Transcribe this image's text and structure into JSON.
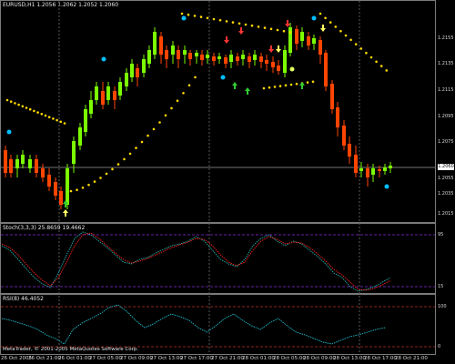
{
  "chart_window": {
    "price_title": "EURUSD,H1  1.2056 1.2062 1.2052 1.2060",
    "stoch_title": "Stoch(3,3,3) 25.8659 19.4662",
    "rsi_title": "RSI(8) 46.4052",
    "copyright": "MetaTrader, © 2001-2005 MetaQuotes Software Corp.",
    "current_price": "1.2060",
    "price_ticks": [
      "1.2155",
      "1.2135",
      "1.2115",
      "1.2095",
      "1.2075",
      "1.2055",
      "1.2035",
      "1.2015"
    ],
    "stoch_ticks": [
      "95",
      "15"
    ],
    "rsi_ticks": [
      "100",
      "0"
    ],
    "time_labels": [
      "26 Oct 2005",
      "26 Oct 21:00",
      "26 Oct 01:00",
      "27 Oct 05:00",
      "27 Oct 09:00",
      "27 Oct 13:00",
      "27 Oct 17:00",
      "27 Oct 21:00",
      "28 Oct 01:00",
      "28 Oct 05:00",
      "28 Oct 09:00",
      "28 Oct 13:00",
      "28 Oct 17:00",
      "28 Oct 21:00"
    ],
    "colors": {
      "bull": "#7cfc00",
      "bear": "#ff4500",
      "sar": "#ffd700",
      "fractal": "#00bfff",
      "up_arrow": "#32cd32",
      "down_arrow": "#ff3333",
      "stoch_main": "#20b2aa",
      "stoch_signal": "#ff2020",
      "rsi_line": "#20c0d0",
      "level_line": "#8a2be2",
      "grid": "#5a5a5a"
    }
  }
}
